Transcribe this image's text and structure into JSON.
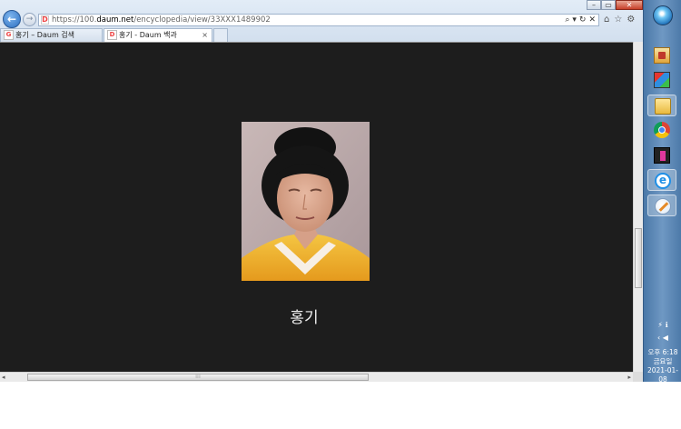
{
  "browser": {
    "address": {
      "url_prefix": "https://100.",
      "url_domain": "daum.net",
      "url_path": "/encyclopedia/view/33XXX1489902"
    },
    "tabs": [
      {
        "label": "홍기 – Daum 검색",
        "active": false
      },
      {
        "label": "홍기 - Daum 백과",
        "active": true
      }
    ],
    "tab_close_glyph": "×"
  },
  "page": {
    "caption": "홍기",
    "background_color": "#1d1d1d"
  },
  "taskbar": {
    "apps": [
      {
        "name": "app-1"
      },
      {
        "name": "app-2"
      },
      {
        "name": "file-explorer"
      },
      {
        "name": "chrome"
      },
      {
        "name": "app-5"
      },
      {
        "name": "internet-explorer",
        "active": true
      },
      {
        "name": "paint"
      }
    ],
    "clock": {
      "time": "오후 6:18",
      "day": "금요일",
      "date": "2021-01-08"
    }
  }
}
